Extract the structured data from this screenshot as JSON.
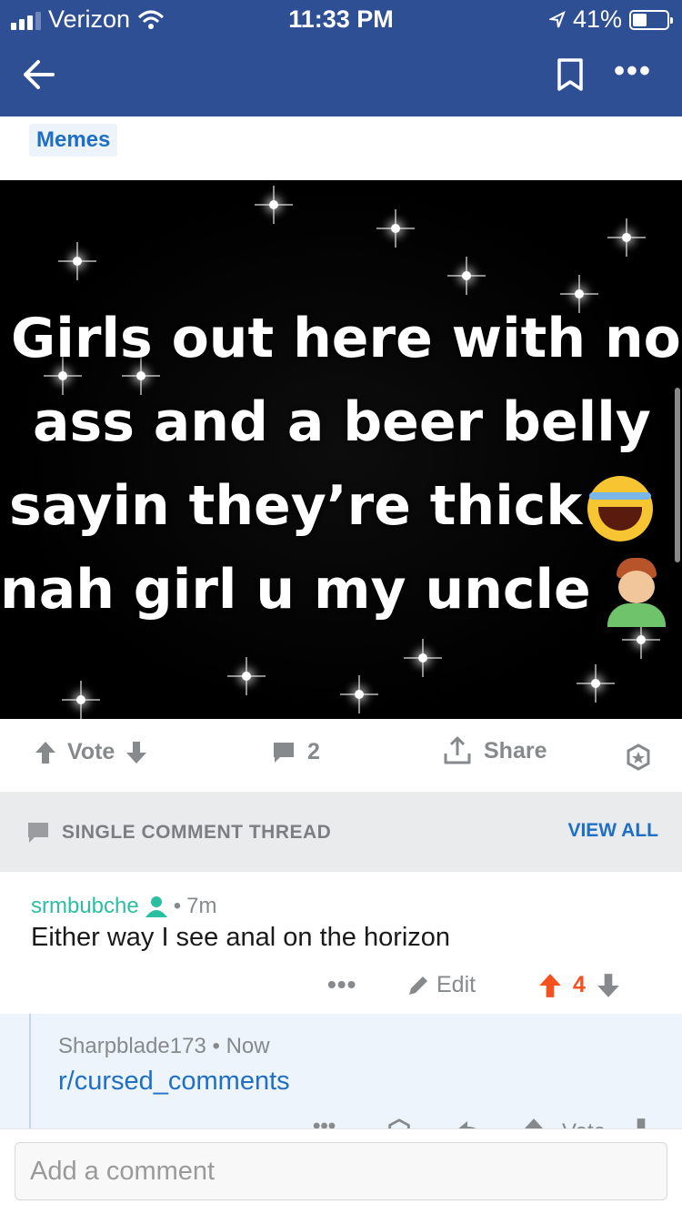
{
  "status_bar": {
    "carrier": "Verizon",
    "time": "11:33 PM",
    "battery_percent": "41%",
    "battery_level": 0.41
  },
  "post": {
    "flair": "Memes",
    "meme_lines": [
      "Girls out here with no",
      "ass and a beer belly",
      "sayin they’re thick",
      "nah girl u my uncle"
    ],
    "emojis": [
      "laughing-tears-emoji",
      "facepalm-emoji"
    ],
    "vote_label": "Vote",
    "comment_count": "2",
    "share_label": "Share"
  },
  "thread": {
    "header_label": "SINGLE COMMENT THREAD",
    "view_all_label": "VIEW ALL"
  },
  "comment": {
    "author": "srmbubche",
    "separator": "•",
    "age": "7m",
    "body": "Either way I see anal on the horizon",
    "more_label": "•••",
    "edit_label": "Edit",
    "score": "4"
  },
  "reply": {
    "author": "Sharpblade173",
    "separator": "•",
    "age": "Now",
    "body": "r/cursed_comments",
    "vote_label": "Vote"
  },
  "composer": {
    "placeholder": "Add a comment"
  },
  "colors": {
    "header_bg": "#2f4f95",
    "link_blue": "#1f6fc5",
    "upvote_orange": "#f4511e",
    "author_teal": "#2bbfa2"
  },
  "icons": [
    "back-arrow-icon",
    "bookmark-icon",
    "more-icon",
    "upvote-icon",
    "downvote-icon",
    "comment-icon",
    "share-icon",
    "award-icon",
    "user-icon",
    "pencil-icon"
  ]
}
